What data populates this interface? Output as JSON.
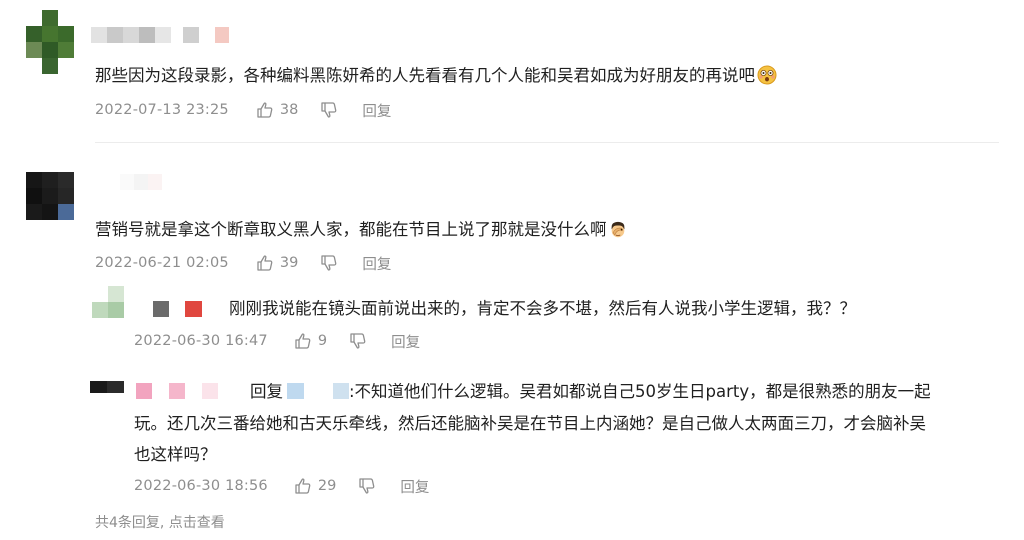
{
  "comments": [
    {
      "text": "那些因为这段录影，各种编料黑陈妍希的人先看看有几个人能和吴君如成为好朋友的再说吧",
      "emoji": "astonished-face-emoji",
      "date": "2022-07-13 23:25",
      "likes": "38",
      "reply_label": "回复"
    },
    {
      "text": "营销号就是拿这个断章取义黑人家，都能在节目上说了那就是没什么啊",
      "emoji": "facepalm-emoji",
      "date": "2022-06-21 02:05",
      "likes": "39",
      "reply_label": "回复",
      "replies": [
        {
          "text": "刚刚我说能在镜头面前说出来的，肯定不会多不堪，然后有人说我小学生逻辑，我？？",
          "date": "2022-06-30 16:47",
          "likes": "9",
          "reply_label": "回复"
        },
        {
          "reply_prefix": "回复",
          "text_line1": ":不知道他们什么逻辑。吴君如都说自己50岁生日party，都是很熟悉的朋友一起",
          "text_line2": "玩。还几次三番给她和古天乐牵线，然后还能脑补吴是在节目上内涵她？是自己做人太两面三刀，才会脑补吴",
          "text_line3": "也这样吗？",
          "date": "2022-06-30 18:56",
          "likes": "29",
          "reply_label": "回复"
        }
      ],
      "more_replies": "共4条回复, 点击查看"
    }
  ],
  "colors": {
    "meta": "#8e8e8e",
    "text": "#1f1f1f",
    "divider": "#ececec"
  }
}
